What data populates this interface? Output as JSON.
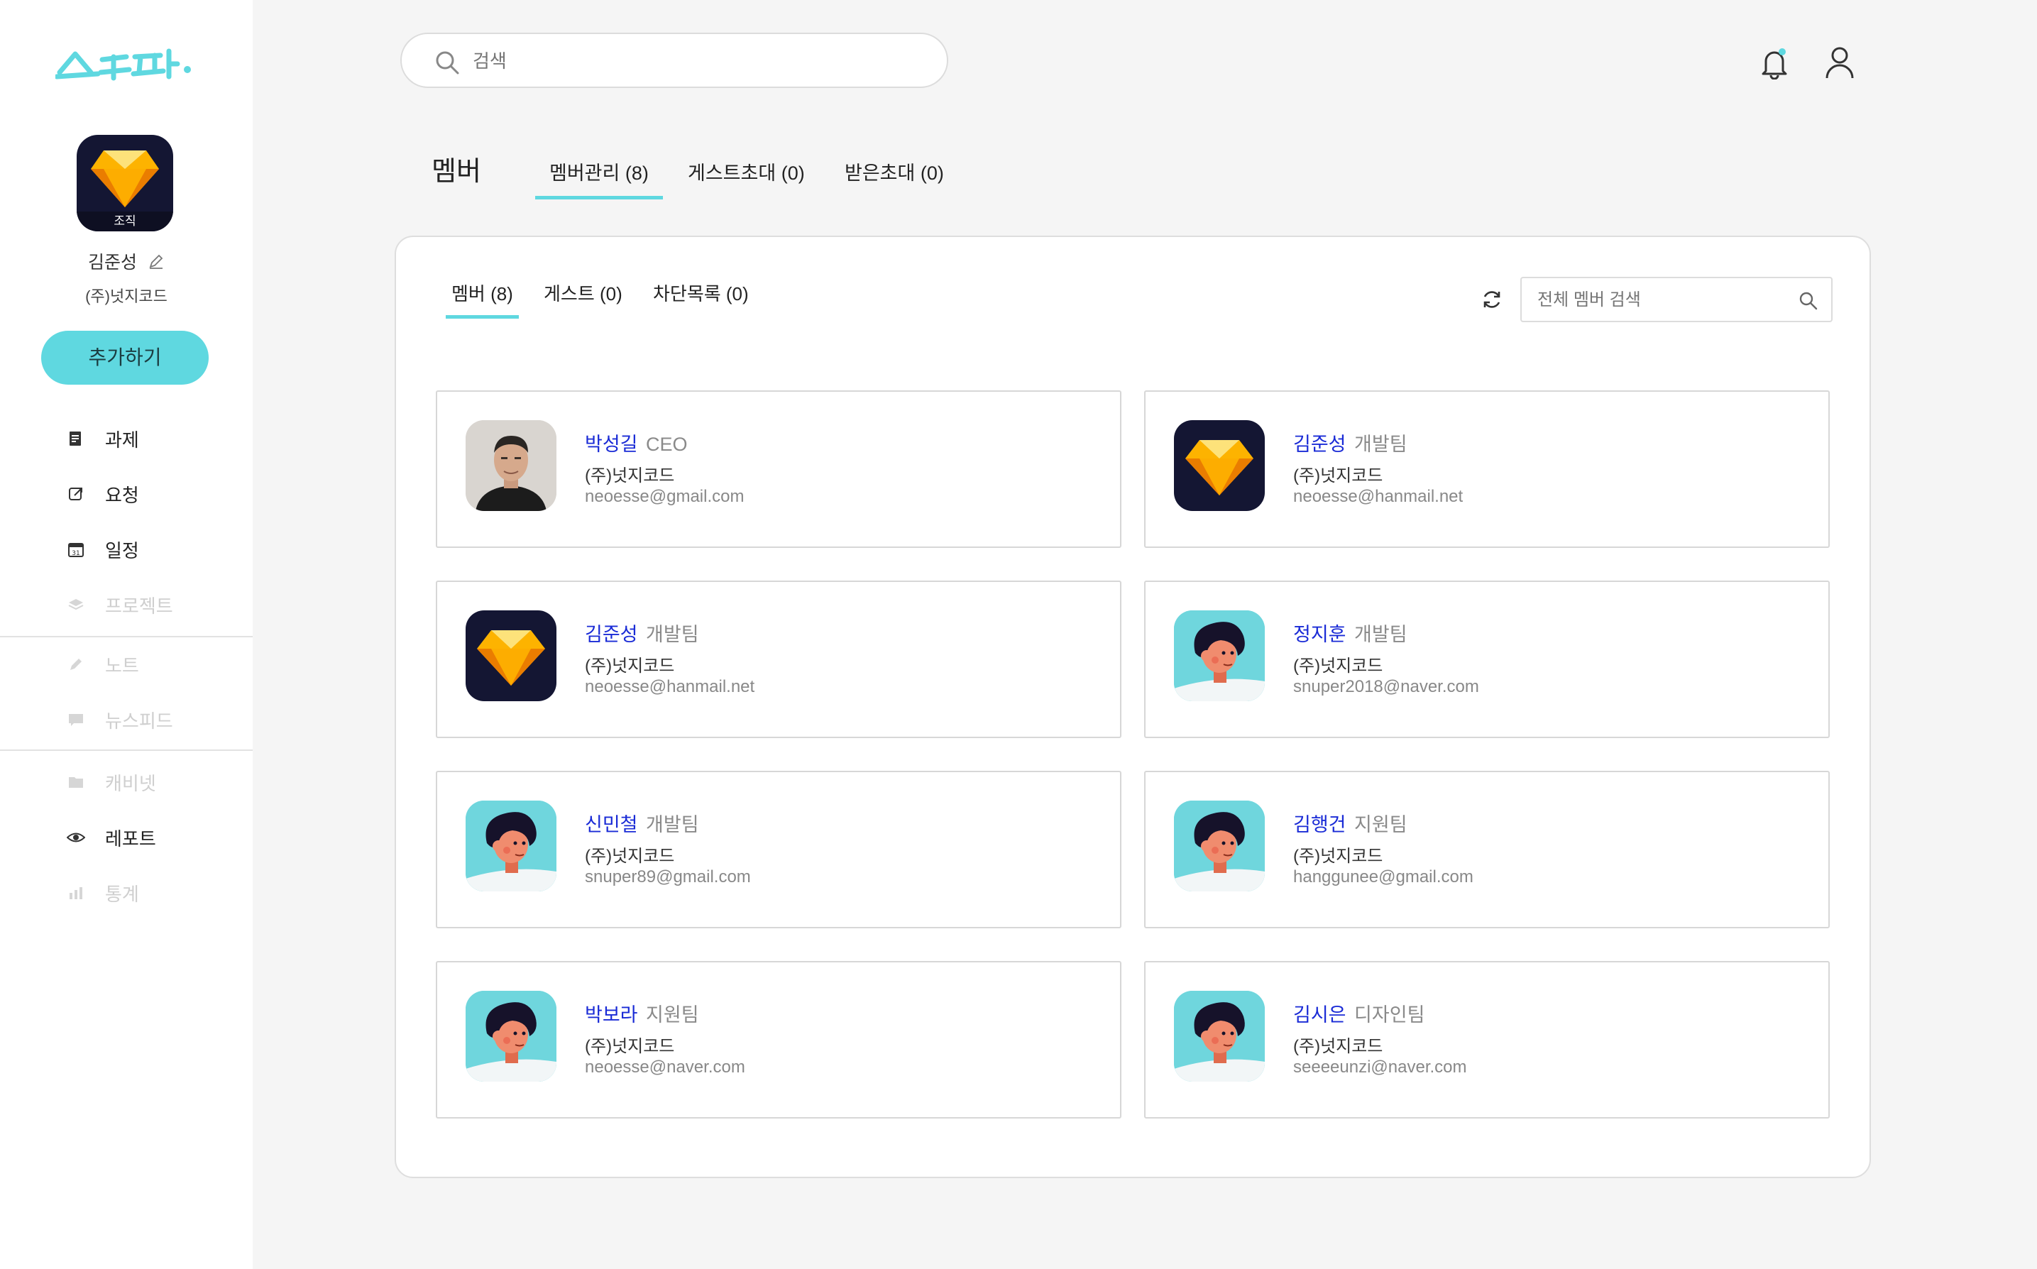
{
  "app": {
    "logo_text": "스누퍼."
  },
  "sidebar": {
    "org_tag": "조직",
    "user_name": "김준성",
    "company": "(주)넛지코드",
    "add_button": "추가하기",
    "nav": [
      {
        "label": "과제",
        "icon": "task-icon",
        "enabled": true
      },
      {
        "label": "요청",
        "icon": "request-icon",
        "enabled": true
      },
      {
        "label": "일정",
        "icon": "calendar-icon",
        "enabled": true
      },
      {
        "label": "프로젝트",
        "icon": "layers-icon",
        "enabled": false
      },
      {
        "label": "노트",
        "icon": "pencil-icon",
        "enabled": false
      },
      {
        "label": "뉴스피드",
        "icon": "chat-icon",
        "enabled": false
      },
      {
        "label": "캐비넷",
        "icon": "folder-icon",
        "enabled": false
      },
      {
        "label": "레포트",
        "icon": "eye-icon",
        "enabled": true
      },
      {
        "label": "통계",
        "icon": "bar-chart-icon",
        "enabled": false
      }
    ]
  },
  "header": {
    "search_placeholder": "검색"
  },
  "page": {
    "title": "멤버",
    "tabs": [
      "멤버관리 (8)",
      "게스트초대 (0)",
      "받은초대 (0)"
    ]
  },
  "panel": {
    "sub_tabs": [
      "멤버 (8)",
      "게스트 (0)",
      "차단목록 (0)"
    ],
    "search_placeholder": "전체 멤버 검색",
    "members": [
      {
        "name": "박성길",
        "team": "CEO",
        "company": "(주)넛지코드",
        "email": "neoesse@gmail.com",
        "avatar": "photo"
      },
      {
        "name": "김준성",
        "team": "개발팀",
        "company": "(주)넛지코드",
        "email": "neoesse@hanmail.net",
        "avatar": "gem"
      },
      {
        "name": "김준성",
        "team": "개발팀",
        "company": "(주)넛지코드",
        "email": "neoesse@hanmail.net",
        "avatar": "gem"
      },
      {
        "name": "정지훈",
        "team": "개발팀",
        "company": "(주)넛지코드",
        "email": "snuper2018@naver.com",
        "avatar": "character"
      },
      {
        "name": "신민철",
        "team": "개발팀",
        "company": "(주)넛지코드",
        "email": "snuper89@gmail.com",
        "avatar": "character"
      },
      {
        "name": "김행건",
        "team": "지원팀",
        "company": "(주)넛지코드",
        "email": "hanggunee@gmail.com",
        "avatar": "character"
      },
      {
        "name": "박보라",
        "team": "지원팀",
        "company": "(주)넛지코드",
        "email": "neoesse@naver.com",
        "avatar": "character"
      },
      {
        "name": "김시은",
        "team": "디자인팀",
        "company": "(주)넛지코드",
        "email": "seeeeunzi@naver.com",
        "avatar": "character"
      }
    ]
  },
  "colors": {
    "accent": "#5fd8e0",
    "name_link": "#1a2bd6"
  }
}
